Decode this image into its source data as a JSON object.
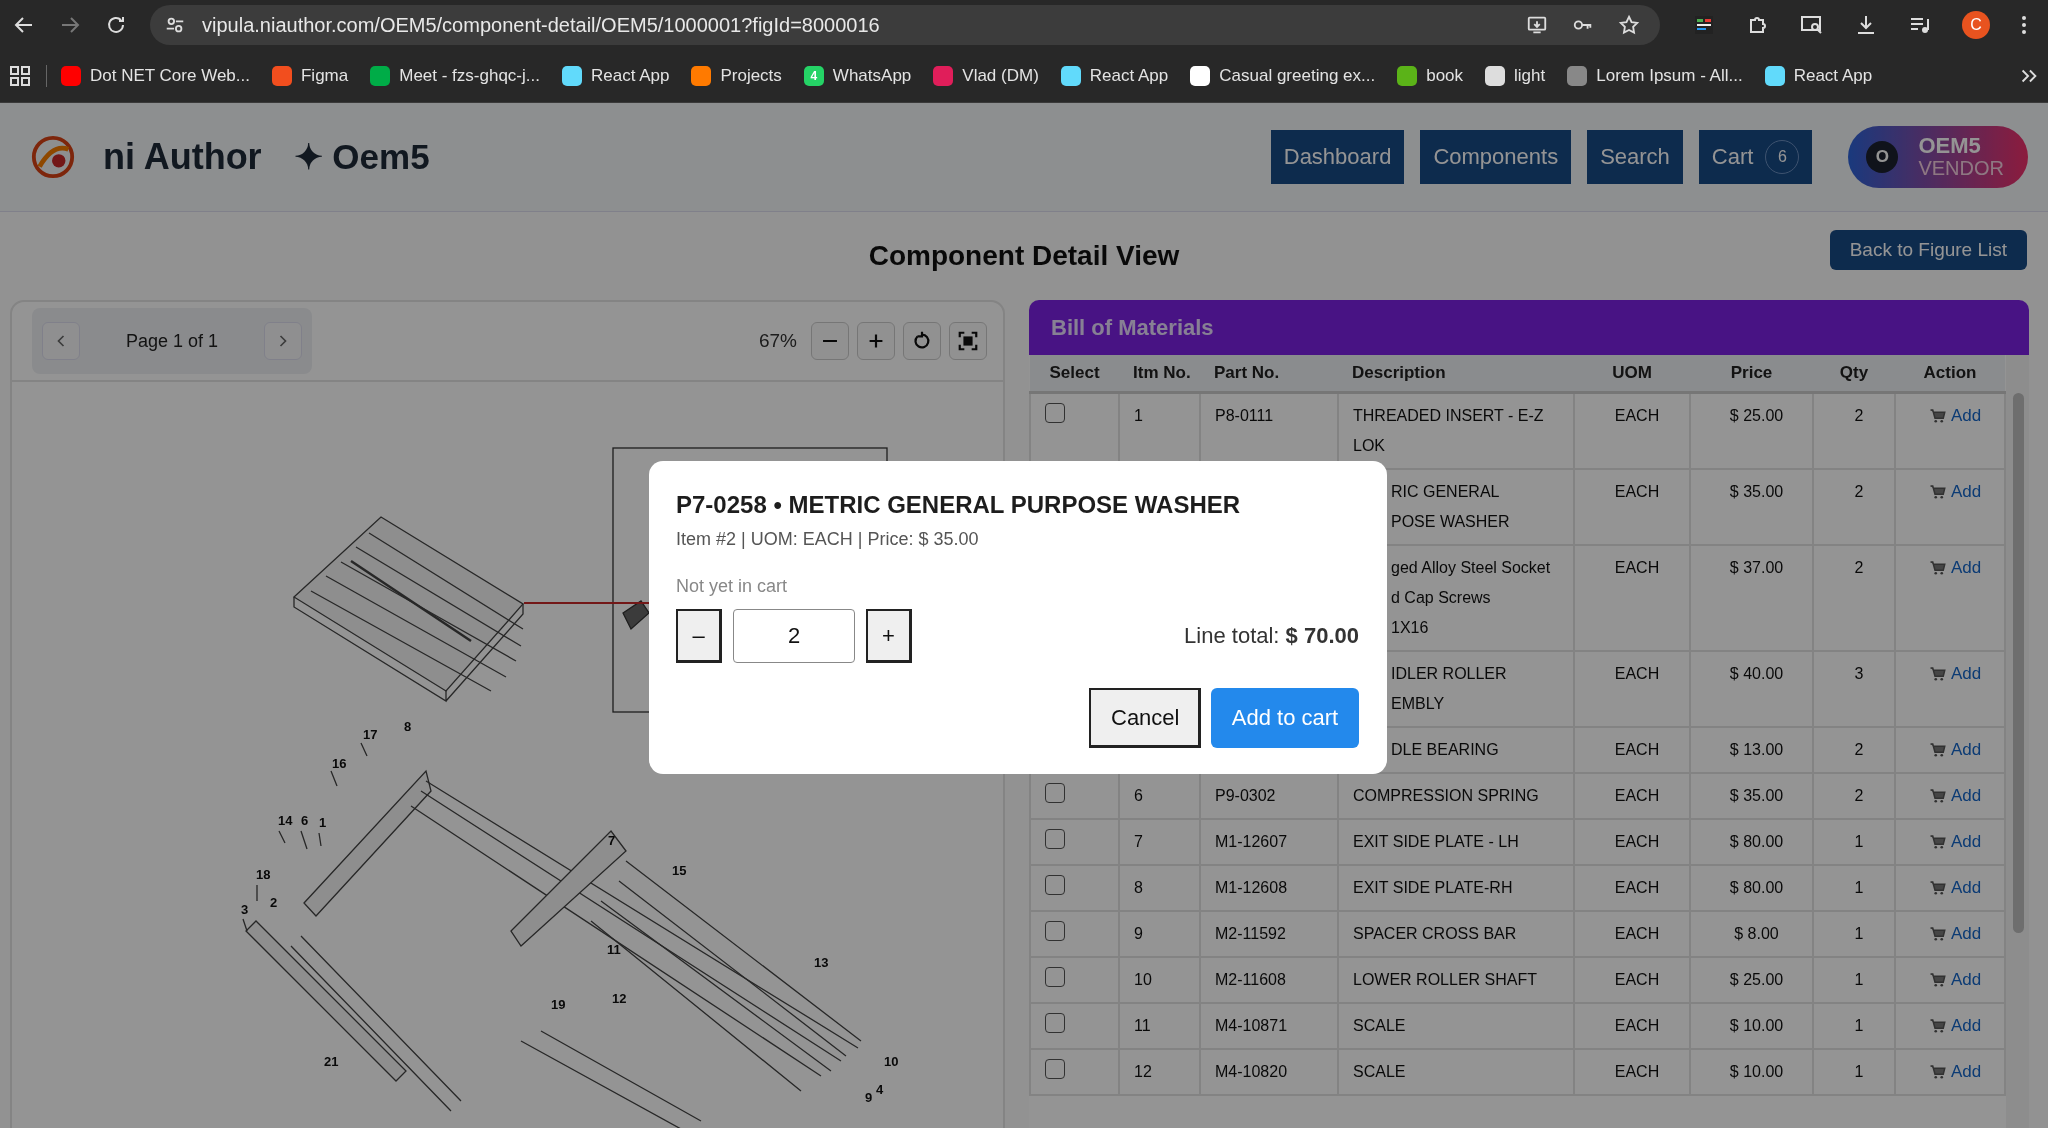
{
  "browser": {
    "url": "vipula.niauthor.com/OEM5/component-detail/OEM5/1000001?figId=8000016",
    "profile_initial": "C",
    "bookmarks": [
      {
        "label": "Dot NET Core Web...",
        "color": "#ff0000"
      },
      {
        "label": "Figma",
        "color": "#f24e1e"
      },
      {
        "label": "Meet - fzs-ghqc-j...",
        "color": "#00ac47"
      },
      {
        "label": "React App",
        "color": "#61dafb"
      },
      {
        "label": "Projects",
        "color": "#ff7a00"
      },
      {
        "label": "WhatsApp",
        "color": "#25d366",
        "badge": "4"
      },
      {
        "label": "Vlad (DM)",
        "color": "#e01e5a"
      },
      {
        "label": "React App",
        "color": "#61dafb"
      },
      {
        "label": "Casual greeting ex...",
        "color": "#ffffff"
      },
      {
        "label": "book",
        "color": "#5bb318"
      },
      {
        "label": "light",
        "color": "#dddddd"
      },
      {
        "label": "Lorem Ipsum - All...",
        "color": "#888888"
      },
      {
        "label": "React App",
        "color": "#61dafb"
      }
    ]
  },
  "header": {
    "brand": "ni Author",
    "org": "✦ Oem5",
    "nav": [
      {
        "label": "Dashboard"
      },
      {
        "label": "Components"
      },
      {
        "label": "Search"
      },
      {
        "label": "Cart",
        "count": "6"
      }
    ],
    "user": {
      "initial": "O",
      "name": "OEM5",
      "role": "VENDOR"
    }
  },
  "page_title": "Component Detail View",
  "back_button": "Back to Figure List",
  "viewer": {
    "page_label": "Page 1 of 1",
    "zoom": "67%",
    "callouts": [
      "17",
      "8",
      "16",
      "14",
      "6",
      "1",
      "18",
      "2",
      "3",
      "7",
      "15",
      "11",
      "13",
      "12",
      "19",
      "21",
      "10",
      "4",
      "9"
    ]
  },
  "bom": {
    "title": "Bill of Materials",
    "columns": [
      "Select",
      "Itm No.",
      "Part No.",
      "Description",
      "UOM",
      "Price",
      "Qty",
      "Action"
    ],
    "rows": [
      {
        "checked": false,
        "item": "1",
        "part": "P8-0111",
        "description": "THREADED INSERT - E-Z LOK",
        "uom": "EACH",
        "price": "$ 25.00",
        "qty": "2",
        "action": "Add"
      },
      {
        "description_lines": [
          "RIC GENERAL",
          "POSE WASHER"
        ],
        "uom": "EACH",
        "price": "$ 35.00",
        "qty": "2",
        "action": "Add"
      },
      {
        "description_lines": [
          "ged Alloy Steel Socket",
          "d Cap Screws",
          "1X16"
        ],
        "uom": "EACH",
        "price": "$ 37.00",
        "qty": "2",
        "action": "Add"
      },
      {
        "description_lines": [
          "IDLER ROLLER",
          "EMBLY"
        ],
        "uom": "EACH",
        "price": "$ 40.00",
        "qty": "3",
        "action": "Add"
      },
      {
        "description_lines": [
          "DLE BEARING"
        ],
        "uom": "EACH",
        "price": "$ 13.00",
        "qty": "2",
        "action": "Add"
      },
      {
        "checked": false,
        "item": "6",
        "part": "P9-0302",
        "description": "COMPRESSION SPRING",
        "uom": "EACH",
        "price": "$ 35.00",
        "qty": "2",
        "action": "Add"
      },
      {
        "checked": false,
        "item": "7",
        "part": "M1-12607",
        "description": "EXIT SIDE PLATE - LH",
        "uom": "EACH",
        "price": "$ 80.00",
        "qty": "1",
        "action": "Add"
      },
      {
        "checked": false,
        "item": "8",
        "part": "M1-12608",
        "description": "EXIT SIDE PLATE-RH",
        "uom": "EACH",
        "price": "$ 80.00",
        "qty": "1",
        "action": "Add"
      },
      {
        "checked": false,
        "item": "9",
        "part": "M2-11592",
        "description": "SPACER CROSS BAR",
        "uom": "EACH",
        "price": "$ 8.00",
        "qty": "1",
        "action": "Add"
      },
      {
        "checked": false,
        "item": "10",
        "part": "M2-11608",
        "description": "LOWER ROLLER SHAFT",
        "uom": "EACH",
        "price": "$ 25.00",
        "qty": "1",
        "action": "Add"
      },
      {
        "checked": false,
        "item": "11",
        "part": "M4-10871",
        "description": "SCALE",
        "uom": "EACH",
        "price": "$ 10.00",
        "qty": "1",
        "action": "Add"
      },
      {
        "checked": false,
        "item": "12",
        "part": "M4-10820",
        "description": "SCALE",
        "uom": "EACH",
        "price": "$ 10.00",
        "qty": "1",
        "action": "Add"
      }
    ]
  },
  "modal": {
    "title": "P7-0258 • METRIC GENERAL PURPOSE WASHER",
    "subtitle": "Item #2 | UOM: EACH | Price: $ 35.00",
    "status": "Not yet in cart",
    "decrement": "–",
    "quantity": "2",
    "increment": "+",
    "line_total": "Line total: **$ 70.00**",
    "buttons": [
      {
        "label": "Cancel",
        "kind": "secondary"
      },
      {
        "label": "Add to cart",
        "kind": "primary"
      }
    ]
  }
}
